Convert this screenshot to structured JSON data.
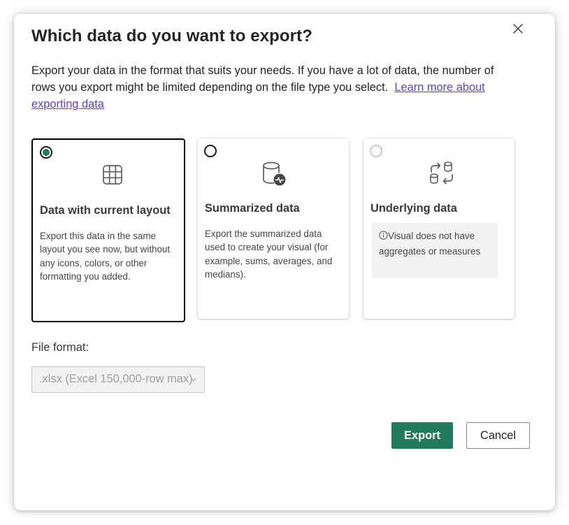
{
  "dialog": {
    "title": "Which data do you want to export?",
    "description": "Export your data in the format that suits your needs. If you have a lot of data, the number of rows you export might be limited depending on the file type you select.",
    "learn_more_link": "Learn more about exporting data",
    "close_icon": "close-icon"
  },
  "options": [
    {
      "title": "Data with current layout",
      "text": "Export this data in the same layout you see now, but without any icons, colors, or other formatting you added.",
      "selected": true,
      "icon": "table-grid-icon"
    },
    {
      "title": "Summarized data",
      "text": "Export the summarized data used to create your visual (for example, sums, averages, and medians).",
      "selected": false,
      "icon": "database-pulse-icon"
    },
    {
      "title": "Underlying data",
      "info": "Visual does not have aggregates or measures",
      "selected": false,
      "disabled": true,
      "icon": "data-transfer-icon"
    }
  ],
  "file_format": {
    "label": "File format:",
    "value": ".xlsx (Excel 150,000-row max)"
  },
  "buttons": {
    "export": "Export",
    "cancel": "Cancel"
  },
  "colors": {
    "accent": "#237b5e",
    "link": "#5b3fd6",
    "disabled_text": "#a19f9d"
  }
}
